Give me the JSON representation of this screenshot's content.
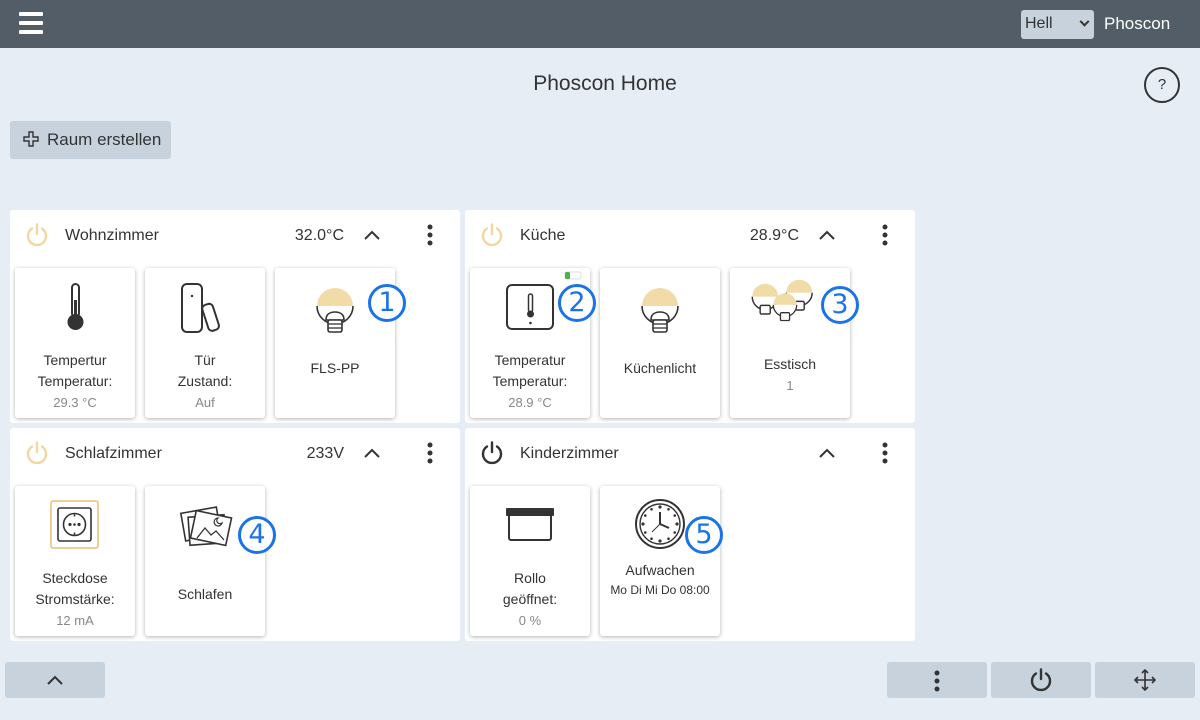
{
  "topbar": {
    "menu_icon": "hamburger-icon",
    "theme": "Hell",
    "app_name": "Phoscon"
  },
  "page": {
    "title": "Phoscon Home",
    "help": "?",
    "create_room": "Raum erstellen"
  },
  "colors": {
    "topbar": "#525d68",
    "background": "#e6edf4",
    "button": "#c8d2dc",
    "power_on": "#efd9a0",
    "badge": "#1a73e8"
  },
  "rooms": [
    {
      "name": "Wohnzimmer",
      "value": "32.0°C",
      "power": "on",
      "cards": [
        {
          "icon": "thermometer-icon",
          "line1": "Tempertur",
          "line2": "Temperatur:",
          "sub": "29.3 °C"
        },
        {
          "icon": "door-sensor-icon",
          "line1": "Tür",
          "line2": "Zustand:",
          "sub": "Auf"
        },
        {
          "icon": "bulb-icon",
          "line1": "FLS-PP",
          "badge": "1"
        }
      ]
    },
    {
      "name": "Küche",
      "value": "28.9°C",
      "power": "on",
      "cards": [
        {
          "icon": "thermostat-icon",
          "line1": "Temperatur",
          "line2": "Temperatur:",
          "sub": "28.9 °C",
          "badge": "2"
        },
        {
          "icon": "bulb-icon",
          "line1": "Küchenlicht"
        },
        {
          "icon": "bulb-group-icon",
          "line1": "Esstisch",
          "sub": "1",
          "badge": "3"
        }
      ]
    },
    {
      "name": "Schlafzimmer",
      "value": "233V",
      "power": "on",
      "cards": [
        {
          "icon": "socket-icon",
          "line1": "Steckdose",
          "line2": "Stromstärke:",
          "sub": "12 mA"
        },
        {
          "icon": "scenes-icon",
          "line1": "Schlafen",
          "badge": "4"
        }
      ]
    },
    {
      "name": "Kinderzimmer",
      "value": "",
      "power": "off",
      "cards": [
        {
          "icon": "blind-icon",
          "line1": "Rollo",
          "line2": "geöffnet:",
          "sub": "0 %"
        },
        {
          "icon": "clock-icon",
          "line1": "Aufwachen",
          "sub": "Mo Di Mi Do 08:00",
          "badge": "5"
        }
      ]
    }
  ],
  "bottom": {
    "collapse_icon": "chevron-up-icon",
    "more_icon": "more-vertical-icon",
    "power_icon": "power-icon",
    "move_icon": "move-icon"
  }
}
